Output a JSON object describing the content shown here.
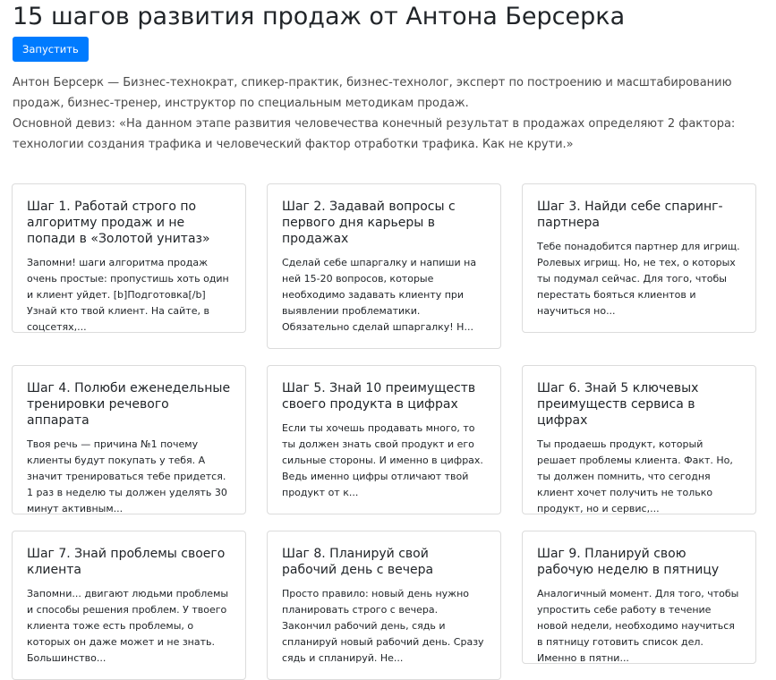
{
  "header": {
    "title": "15 шагов развития продаж от Антона Берсерка",
    "run_button_label": "Запустить"
  },
  "intro": {
    "line1": "Антон Берсерк — Бизнес-технократ, спикер-практик, бизнес-технолог, эксперт по построению и масштабированию продаж, бизнес-тренер, инструктор по специальным методикам продаж.",
    "line2": "Основной девиз: «На данном этапе развития человечества конечный результат в продажах определяют 2 фактора: технологии создания трафика и человеческий фактор отработки трафика. Как не крути.»"
  },
  "cards": [
    {
      "title": "Шаг 1. Работай строго по алгоритму продаж и не попади в «Золотой унитаз»",
      "text": "Запомни! шаги алгоритма продаж очень простые: пропустишь хоть один и клиент уйдет. [b]Подготовка[/b] Узнай кто твой клиент. На сайте, в соцсетях,..."
    },
    {
      "title": "Шаг 2. Задавай вопросы с первого дня карьеры в продажах",
      "text": "Сделай себе шпаргалку и напиши на ней 15-20 вопросов, которые необходимо задавать клиенту при выявлении проблематики. Обязательно сделай шпаргалку! Н..."
    },
    {
      "title": "Шаг 3. Найди себе спаринг-партнера",
      "text": "Тебе понадобится партнер для игрищ. Ролевых игрищ. Но, не тех, о которых ты подумал сейчас. Для того, чтобы перестать бояться клиентов и научиться но..."
    },
    {
      "title": "Шаг 4. Полюби еженедельные тренировки речевого аппарата",
      "text": "Твоя речь — причина №1 почему клиенты будут покупать у тебя. А значит тренироваться тебе придется. 1 раз в неделю ты должен уделять 30 минут активным..."
    },
    {
      "title": "Шаг 5. Знай 10 преимуществ своего продукта в цифрах",
      "text": "Если ты хочешь продавать много, то ты должен знать свой продукт и его сильные стороны. И именно в цифрах. Ведь именно цифры отличают твой продукт от к..."
    },
    {
      "title": "Шаг 6. Знай 5 ключевых преимуществ сервиса в цифрах",
      "text": "Ты продаешь продукт, который решает проблемы клиента. Факт. Но, ты должен помнить, что сегодня клиент хочет получить не только продукт, но и сервис,..."
    },
    {
      "title": "Шаг 7. Знай проблемы своего клиента",
      "text": "Запомни... двигают людьми проблемы и способы решения проблем. У твоего клиента тоже есть проблемы, о которых он даже может и не знать. Большинство..."
    },
    {
      "title": "Шаг 8. Планируй свой рабочий день с вечера",
      "text": "Просто правило: новый день нужно планировать строго с вечера. Закончил рабочий день, сядь и спланируй новый рабочий день. Сразу сядь и спланируй. Не..."
    },
    {
      "title": "Шаг 9. Планируй свою рабочую неделю в пятницу",
      "text": "Аналогичный момент. Для того, чтобы упростить себе работу в течение новой недели, необходимо научиться в пятницу готовить список дел. Именно в пятни..."
    }
  ]
}
